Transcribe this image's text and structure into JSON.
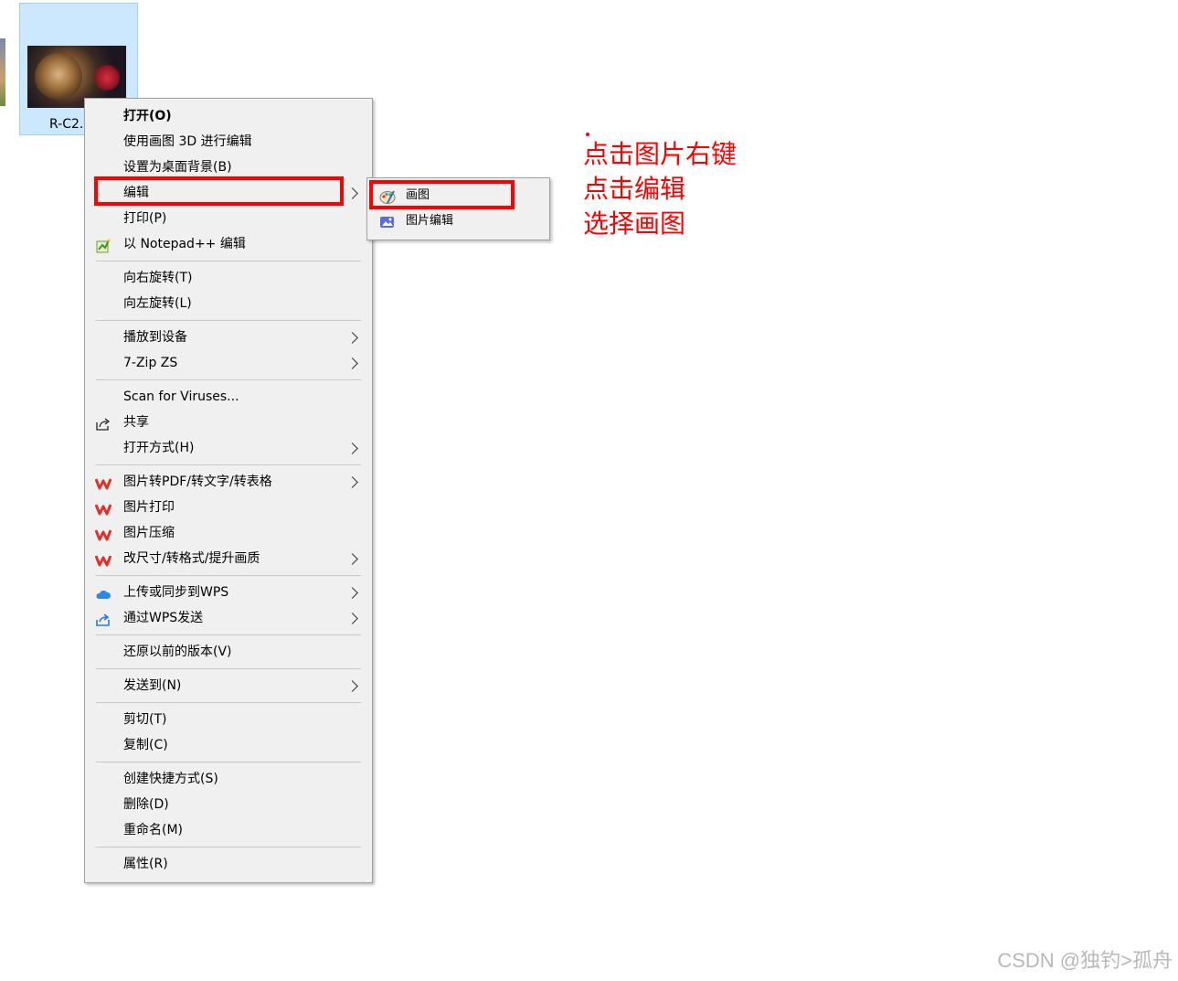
{
  "desktop": {
    "file_name": "R-C2."
  },
  "context_menu": {
    "groups": [
      [
        {
          "label": "打开(O)",
          "bold": true
        },
        {
          "label": "使用画图 3D 进行编辑"
        },
        {
          "label": "设置为桌面背景(B)"
        },
        {
          "label": "编辑",
          "submenu": true
        },
        {
          "label": "打印(P)"
        },
        {
          "label": "以 Notepad++ 编辑",
          "icon": "notepad-plus-plus-icon"
        }
      ],
      [
        {
          "label": "向右旋转(T)"
        },
        {
          "label": "向左旋转(L)"
        }
      ],
      [
        {
          "label": "播放到设备",
          "submenu": true
        },
        {
          "label": "7-Zip ZS",
          "submenu": true
        }
      ],
      [
        {
          "label": "Scan for Viruses..."
        },
        {
          "label": "共享",
          "icon": "share-icon"
        },
        {
          "label": "打开方式(H)",
          "submenu": true
        }
      ],
      [
        {
          "label": "图片转PDF/转文字/转表格",
          "icon": "wps-icon",
          "submenu": true
        },
        {
          "label": "图片打印",
          "icon": "wps-icon"
        },
        {
          "label": "图片压缩",
          "icon": "wps-icon"
        },
        {
          "label": "改尺寸/转格式/提升画质",
          "icon": "wps-icon",
          "submenu": true
        }
      ],
      [
        {
          "label": "上传或同步到WPS",
          "icon": "cloud-icon",
          "submenu": true
        },
        {
          "label": "通过WPS发送",
          "icon": "send-icon",
          "submenu": true
        }
      ],
      [
        {
          "label": "还原以前的版本(V)"
        }
      ],
      [
        {
          "label": "发送到(N)",
          "submenu": true
        }
      ],
      [
        {
          "label": "剪切(T)"
        },
        {
          "label": "复制(C)"
        }
      ],
      [
        {
          "label": "创建快捷方式(S)"
        },
        {
          "label": "删除(D)"
        },
        {
          "label": "重命名(M)"
        }
      ],
      [
        {
          "label": "属性(R)"
        }
      ]
    ]
  },
  "submenu": {
    "items": [
      {
        "label": "画图",
        "icon": "paint-icon"
      },
      {
        "label": "图片编辑",
        "icon": "photo-edit-icon"
      }
    ]
  },
  "annotation": {
    "lines": [
      "点击图片右键",
      "点击编辑",
      "选择画图"
    ],
    "color": "#ff0000"
  },
  "watermark": "CSDN @独钓>孤舟"
}
